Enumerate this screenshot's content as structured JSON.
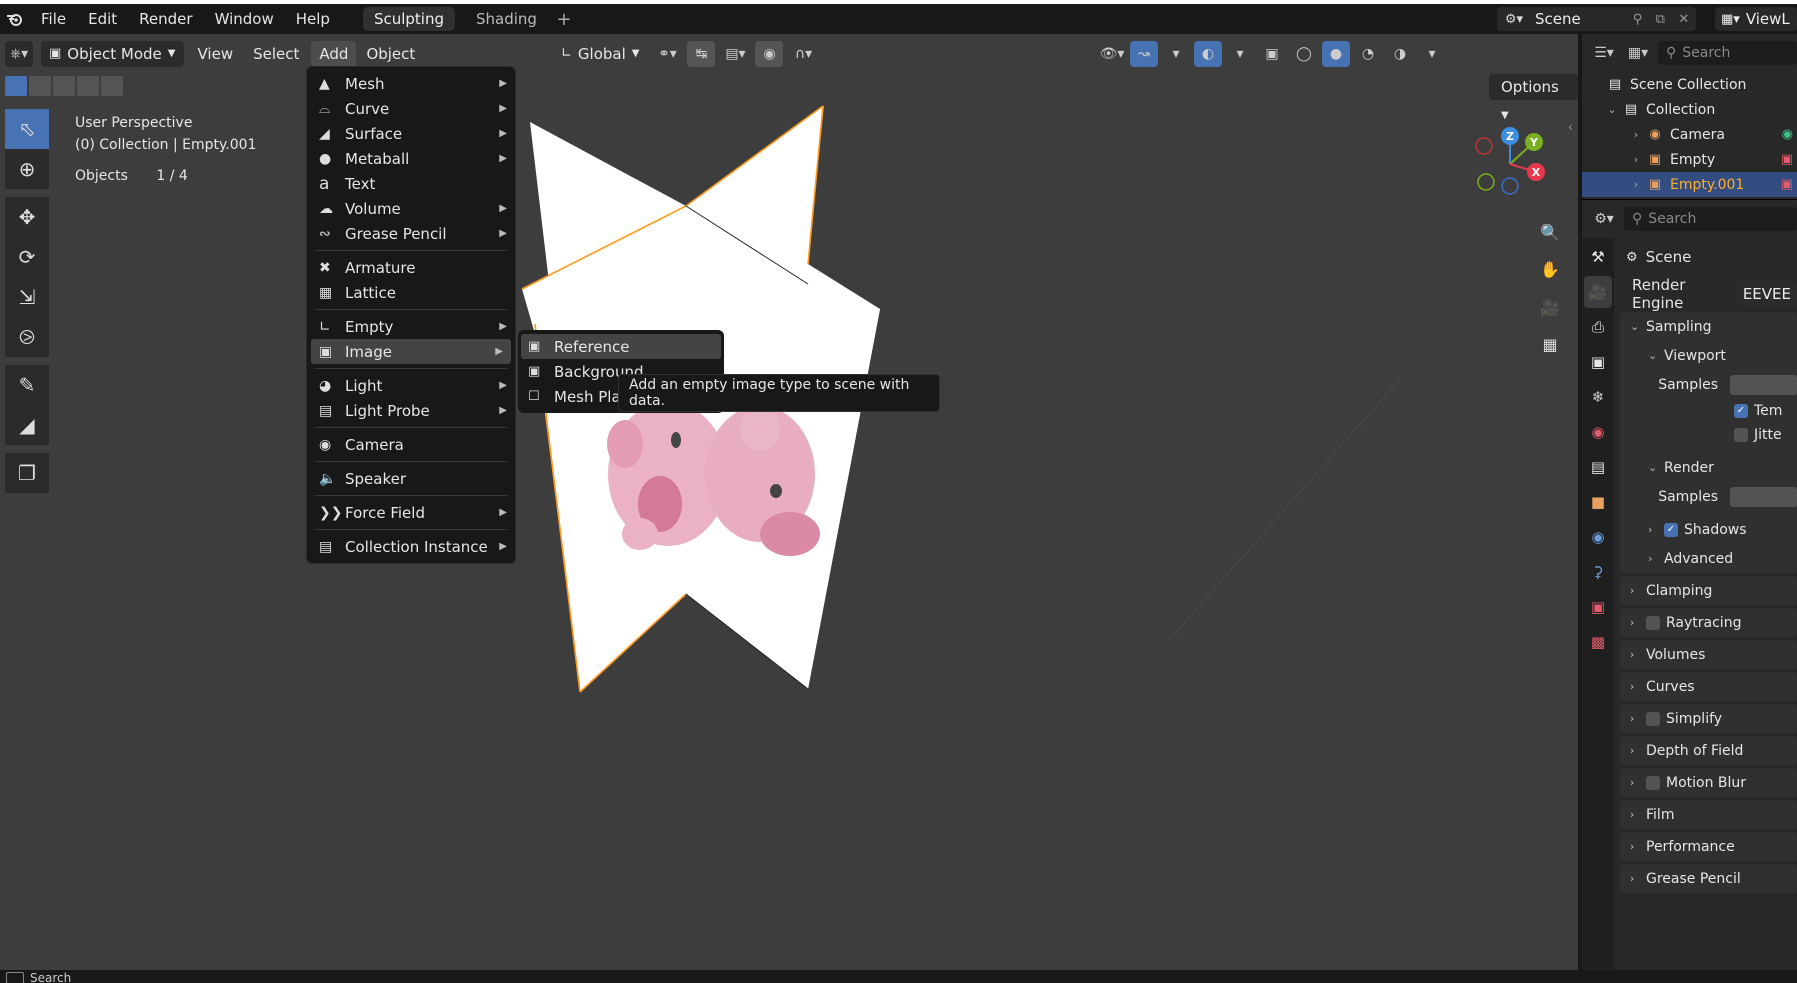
{
  "topbar": {
    "menus": [
      "File",
      "Edit",
      "Render",
      "Window",
      "Help"
    ],
    "workspaces": [
      "Sculpting",
      "Shading"
    ],
    "scene_name": "Scene",
    "view_layer": "ViewL"
  },
  "viewport": {
    "mode": "Object Mode",
    "header_menus": [
      "View",
      "Select",
      "Add",
      "Object"
    ],
    "transform_orientation": "Global",
    "options_label": "Options",
    "info_line1": "User Perspective",
    "info_line2": "(0) Collection | Empty.001",
    "objects_label": "Objects",
    "objects_count": "1 / 4",
    "gizmo": {
      "z": "Z",
      "y": "Y",
      "x": "X"
    }
  },
  "add_menu": {
    "items": [
      {
        "label": "Mesh",
        "icon": "mesh-icon",
        "submenu": true
      },
      {
        "label": "Curve",
        "icon": "curve-icon",
        "submenu": true
      },
      {
        "label": "Surface",
        "icon": "surface-icon",
        "submenu": true
      },
      {
        "label": "Metaball",
        "icon": "metaball-icon",
        "submenu": true
      },
      {
        "label": "Text",
        "icon": "text-icon",
        "submenu": false
      },
      {
        "label": "Volume",
        "icon": "volume-icon",
        "submenu": true
      },
      {
        "label": "Grease Pencil",
        "icon": "grease-pencil-icon",
        "submenu": true
      },
      {
        "label": "Armature",
        "icon": "armature-icon",
        "submenu": false
      },
      {
        "label": "Lattice",
        "icon": "lattice-icon",
        "submenu": false
      },
      {
        "label": "Empty",
        "icon": "empty-icon",
        "submenu": true
      },
      {
        "label": "Image",
        "icon": "image-icon",
        "submenu": true
      },
      {
        "label": "Light",
        "icon": "light-icon",
        "submenu": true
      },
      {
        "label": "Light Probe",
        "icon": "light-probe-icon",
        "submenu": true
      },
      {
        "label": "Camera",
        "icon": "camera-icon",
        "submenu": false
      },
      {
        "label": "Speaker",
        "icon": "speaker-icon",
        "submenu": false
      },
      {
        "label": "Force Field",
        "icon": "force-field-icon",
        "submenu": true
      },
      {
        "label": "Collection Instance",
        "icon": "collection-instance-icon",
        "submenu": true
      }
    ],
    "highlighted": "Image"
  },
  "image_submenu": {
    "items": [
      "Reference",
      "Background",
      "Mesh Pla"
    ],
    "highlighted": "Reference"
  },
  "tooltip": "Add an empty image type to scene with data.",
  "outliner": {
    "search_placeholder": "Search",
    "rows": [
      {
        "label": "Scene Collection",
        "indent": 0
      },
      {
        "label": "Collection",
        "indent": 1
      },
      {
        "label": "Camera",
        "indent": 2
      },
      {
        "label": "Empty",
        "indent": 2
      },
      {
        "label": "Empty.001",
        "indent": 2,
        "selected": true
      }
    ]
  },
  "properties": {
    "search_placeholder": "Search",
    "scene_label": "Scene",
    "render_engine_label": "Render Engine",
    "render_engine_value": "EEVEE",
    "panels": {
      "sampling": "Sampling",
      "viewport": "Viewport",
      "samples": "Samples",
      "temporal": "Tem",
      "jitter": "Jitte",
      "render": "Render",
      "render_samples": "Samples",
      "shadows": "Shadows",
      "advanced": "Advanced",
      "clamping": "Clamping",
      "raytracing": "Raytracing",
      "volumes": "Volumes",
      "curves": "Curves",
      "simplify": "Simplify",
      "depth_of_field": "Depth of Field",
      "motion_blur": "Motion Blur",
      "film": "Film",
      "performance": "Performance",
      "grease_pencil": "Grease Pencil"
    }
  },
  "statusbar": {
    "search": "Search"
  },
  "colors": {
    "accent": "#4772b3",
    "selection_outline": "#ffaf29",
    "panel": "#303030",
    "viewport": "#3d3d3d"
  }
}
